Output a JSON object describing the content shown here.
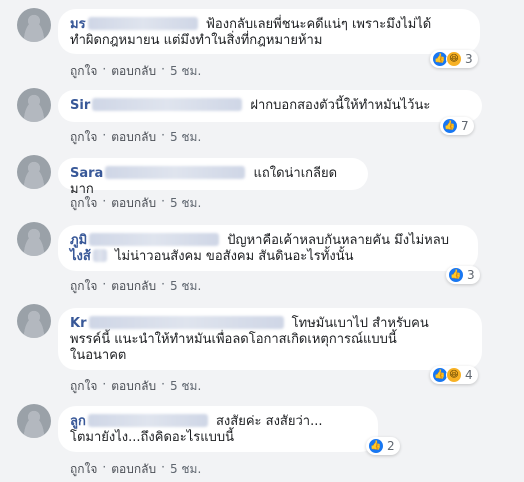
{
  "comments": [
    {
      "name": "มร",
      "text_line1": "ฟ้องกลับเลยพี่ชนะคดีแน่ๆ เพราะมึงไม่ได้",
      "text_line2": "ทำผิดกฎหมายน แต่มึงทำในสิ่งที่กฎหมายห้าม",
      "reactions": [
        "like",
        "haha"
      ],
      "reaction_count": "3",
      "like_label": "ถูกใจ",
      "reply_label": "ตอบกลับ",
      "time": "5 ชม."
    },
    {
      "name": "Sir",
      "text_line1": "ฝากบอกสองตัวนี้ให้ทำหมันไว้นะ",
      "reactions": [
        "like"
      ],
      "reaction_count": "7",
      "like_label": "ถูกใจ",
      "reply_label": "ตอบกลับ",
      "time": "5 ชม."
    },
    {
      "name": "Sara",
      "text_line1": "แถใดน่าเกลียดมาก",
      "like_label": "ถูกใจ",
      "reply_label": "ตอบกลับ",
      "time": "5 ชม."
    },
    {
      "name": "ภูมิ",
      "text_line1": "ปัญหาคือเค้าหลบกันหลายคัน มึงไม่หลบ",
      "name_line2_prefix": "ไงส้",
      "text_line2": "ไม่น่าวอนสังคม ขอสังคม สันดินอะไรทั้งนั้น",
      "reactions": [
        "like"
      ],
      "reaction_count": "3",
      "like_label": "ถูกใจ",
      "reply_label": "ตอบกลับ",
      "time": "5 ชม."
    },
    {
      "name": "Kr",
      "text_line1": "โทษมันเบาไป สำหรับคน",
      "text_line2": "พรรค์นี้ แนะนำให้ทำหมันเพื่อลดโอกาสเกิดเหตุการณ์แบบนี้",
      "text_line3": "ในอนาคต",
      "reactions": [
        "like",
        "haha"
      ],
      "reaction_count": "4",
      "like_label": "ถูกใจ",
      "reply_label": "ตอบกลับ",
      "time": "5 ชม."
    },
    {
      "name": "ลูก",
      "text_line1": "สงสัยค่ะ สงสัยว่า...",
      "text_line2": "โตมายังไง...ถึงคิดอะไรแบบนี้",
      "reactions": [
        "like"
      ],
      "reaction_count": "2",
      "like_label": "ถูกใจ",
      "reply_label": "ตอบกลับ",
      "time": "5 ชม."
    }
  ],
  "icons": {
    "like": "like-icon",
    "haha": "haha-icon"
  },
  "colors": {
    "name": "#385898",
    "like": "#1877f2",
    "haha": "#f7b125",
    "background": "#f2f3f5"
  }
}
